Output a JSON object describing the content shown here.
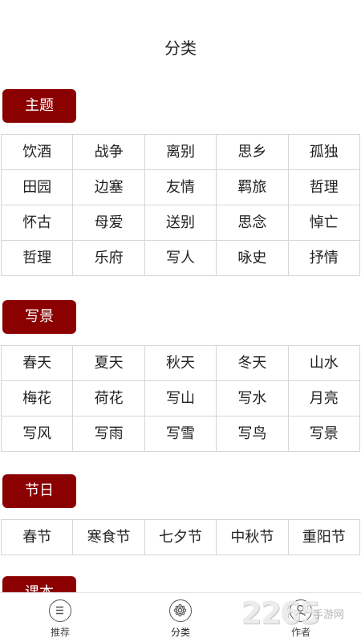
{
  "header": {
    "title": "分类"
  },
  "sections": [
    {
      "label": "主题",
      "items": [
        "饮酒",
        "战争",
        "离别",
        "思乡",
        "孤独",
        "田园",
        "边塞",
        "友情",
        "羁旅",
        "哲理",
        "怀古",
        "母爱",
        "送别",
        "思念",
        "悼亡",
        "哲理",
        "乐府",
        "写人",
        "咏史",
        "抒情"
      ]
    },
    {
      "label": "写景",
      "items": [
        "春天",
        "夏天",
        "秋天",
        "冬天",
        "山水",
        "梅花",
        "荷花",
        "写山",
        "写水",
        "月亮",
        "写风",
        "写雨",
        "写雪",
        "写鸟",
        "写景"
      ]
    },
    {
      "label": "节日",
      "items": [
        "春节",
        "寒食节",
        "七夕节",
        "中秋节",
        "重阳节"
      ]
    },
    {
      "label": "课本"
    }
  ],
  "tabbar": {
    "tabs": [
      {
        "label": "推荐",
        "icon": "list-icon"
      },
      {
        "label": "分类",
        "icon": "category-icon"
      },
      {
        "label": "作者",
        "icon": "author-icon"
      }
    ],
    "active": "分类"
  },
  "watermark": {
    "number": "2265",
    "text": "手游网"
  },
  "colors": {
    "accent": "#8b0000",
    "grid_line": "#d6d6d6"
  }
}
